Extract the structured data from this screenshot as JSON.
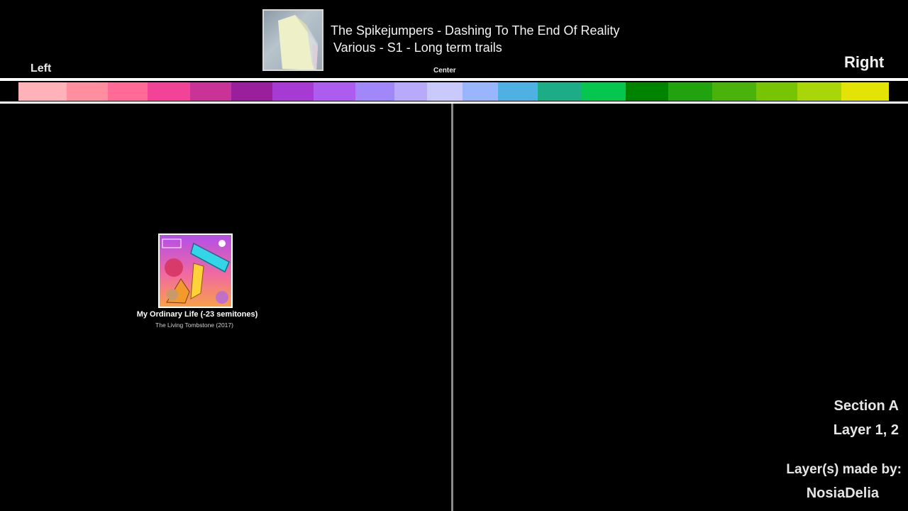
{
  "header": {
    "track_title": "The Spikejumpers - Dashing To The End Of Reality",
    "track_sub": "Various - S1 - Long term trails",
    "label_left": "Left",
    "label_center": "Center",
    "label_right": "Right",
    "art_icon": "paper-icon"
  },
  "color_bar": {
    "segments": [
      "#000000",
      "#ffb3b8",
      "#ff8f9e",
      "#ff6a96",
      "#f24399",
      "#c93296",
      "#9a1f9c",
      "#a73ad3",
      "#ad5cf0",
      "#a287f8",
      "#b9a9fb",
      "#c9c9fc",
      "#99b5fb",
      "#4fb0e4",
      "#1cad86",
      "#06c64f",
      "#008400",
      "#21a20f",
      "#49b30c",
      "#76c404",
      "#a8d608",
      "#e4e306",
      "#000000"
    ]
  },
  "song_card": {
    "title": "My Ordinary Life (-23 semitones)",
    "artist": "The Living Tombstone (2017)",
    "cover_icon": "album-cover-icon"
  },
  "info": {
    "section": "Section A",
    "layer": "Layer 1, 2",
    "made_by_label": "Layer(s) made by:",
    "author": "NosiaDelia"
  }
}
